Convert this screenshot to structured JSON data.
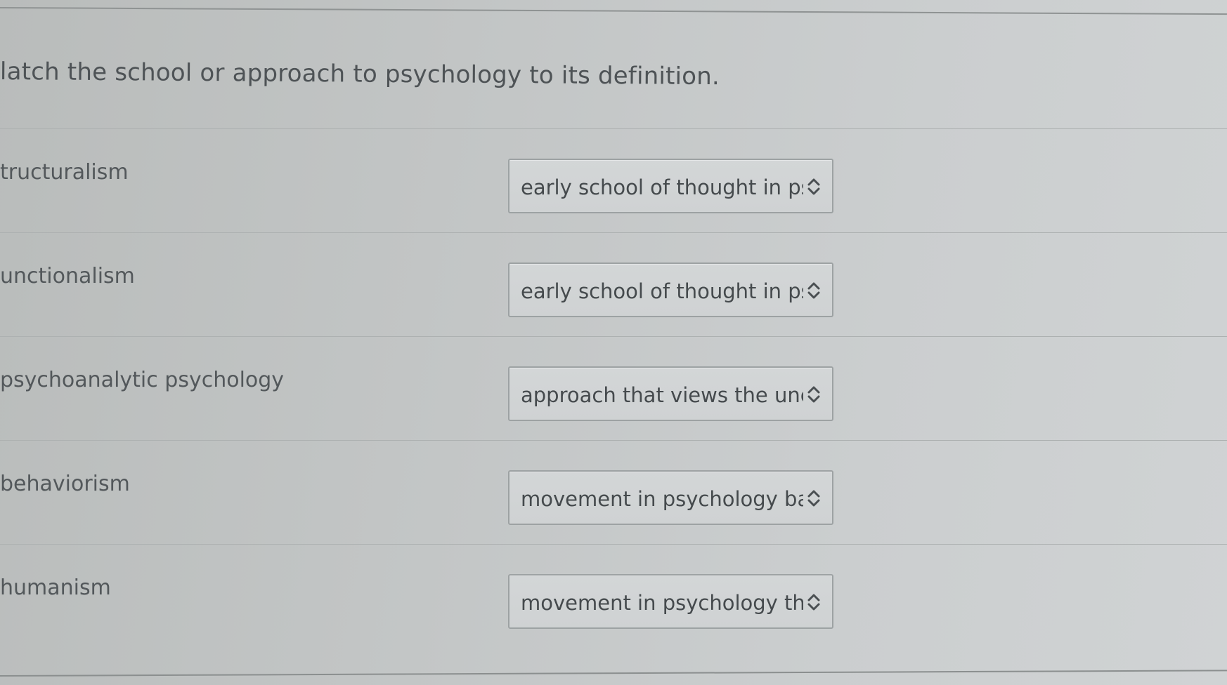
{
  "question": {
    "text": "latch the school or approach to psychology to its definition."
  },
  "rows": [
    {
      "term": "tructuralism",
      "selected": "early school of thought in psychology"
    },
    {
      "term": "unctionalism",
      "selected": "early school of thought in psychology"
    },
    {
      "term": "psychoanalytic psychology",
      "selected": "approach that views the unconscious"
    },
    {
      "term": "behaviorism",
      "selected": "movement in psychology based"
    },
    {
      "term": "humanism",
      "selected": "movement in psychology that v"
    }
  ],
  "icons": {
    "select_arrow": "up-down-chevron-icon"
  },
  "colors": {
    "page_background": "#c4c7c8",
    "text": "#4a4f52",
    "select_border": "#9da2a3"
  }
}
